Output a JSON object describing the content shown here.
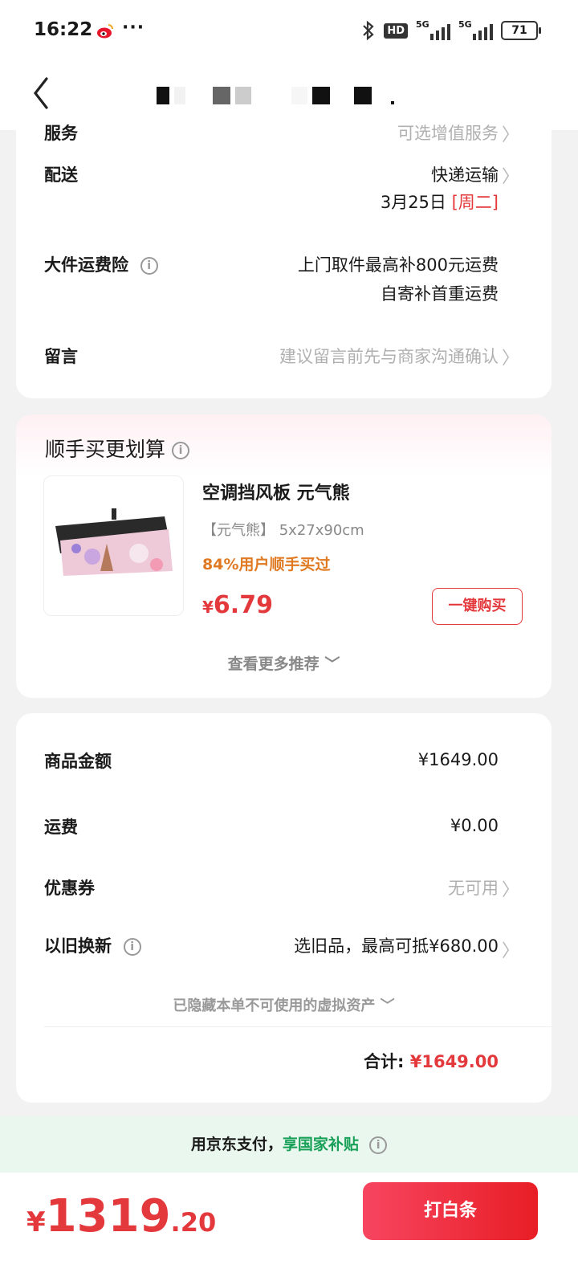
{
  "status_bar": {
    "time": "16:22",
    "more": "···",
    "hd": "HD",
    "signal_1": "5G",
    "signal_2": "5G",
    "battery": "71"
  },
  "nav": {
    "back_icon": "chevron-left-icon"
  },
  "shipping_card": {
    "service_label": "服务",
    "service_value": "可选增值服务",
    "delivery_label": "配送",
    "delivery_method": "快递运输",
    "delivery_date": "3月25日",
    "delivery_day": "[周二]",
    "insurance_label": "大件运费险",
    "insurance_line1": "上门取件最高补800元运费",
    "insurance_line2": "自寄补首重运费",
    "message_label": "留言",
    "message_placeholder": "建议留言前先与商家沟通确认"
  },
  "addon_card": {
    "title": "顺手买更划算",
    "product_name": "空调挡风板 元气熊",
    "product_spec": "【元气熊】 5x27x90cm",
    "buyers": "84%用户顺手买过",
    "price_symbol": "¥",
    "price": "6.79",
    "buy_button": "一键购买",
    "more": "查看更多推荐"
  },
  "summary_card": {
    "goods_label": "商品金额",
    "goods_value": "¥1649.00",
    "freight_label": "运费",
    "freight_value": "¥0.00",
    "coupon_label": "优惠券",
    "coupon_value": "无可用",
    "tradein_label": "以旧换新",
    "tradein_value": "选旧品，最高可抵¥680.00",
    "hidden_assets": "已隐藏本单不可使用的虚拟资产",
    "total_label": "合计:",
    "total_value": "¥1649.00"
  },
  "subsidy": {
    "prefix": "用京东支付，",
    "highlight": "享国家补贴"
  },
  "bottom": {
    "yen": "¥",
    "int": "1319",
    "dec": ".20",
    "pay_button": "打白条"
  },
  "colors": {
    "accent_red": "#e4393c",
    "green": "#18a058",
    "orange": "#e07a22"
  }
}
